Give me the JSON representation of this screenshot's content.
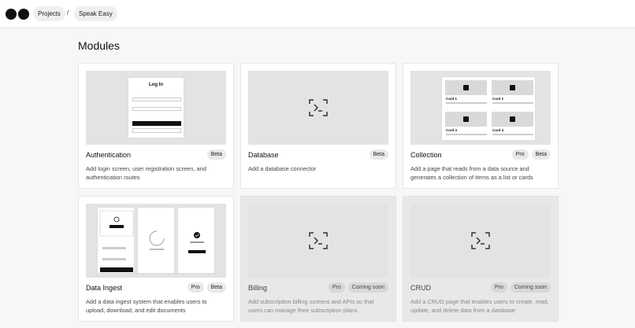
{
  "breadcrumb": {
    "projects": "Projects",
    "separator": "/",
    "current": "Speak Easy"
  },
  "page": {
    "title": "Modules"
  },
  "modules": [
    {
      "name": "Authentication",
      "badges": [
        "Beta"
      ],
      "description": "Add login screen, user registration screen, and authentication routes",
      "thumb": "login-mockup",
      "available": true
    },
    {
      "name": "Database",
      "badges": [
        "Beta"
      ],
      "description": "Add a database connector",
      "thumb": "terminal-icon",
      "available": true
    },
    {
      "name": "Collection",
      "badges": [
        "Pro",
        "Beta"
      ],
      "description": "Add a page that reads from a data source and generates a collection of items as a list or cards",
      "thumb": "cards-mockup",
      "available": true
    },
    {
      "name": "Data Ingest",
      "badges": [
        "Pro",
        "Beta"
      ],
      "description": "Add a data ingest system that enables users to upload, download, and edit documents",
      "thumb": "upload-mockup",
      "available": true
    },
    {
      "name": "Billing",
      "badges": [
        "Pro",
        "Coming soon"
      ],
      "description": "Add subscription billing screens and APIs so that users can manage their subscription plans",
      "thumb": "terminal-icon",
      "available": false
    },
    {
      "name": "CRUD",
      "badges": [
        "Pro",
        "Coming soon"
      ],
      "description": "Add a CRUD page that enables users to create, read, update, and delete data from a database",
      "thumb": "terminal-icon",
      "available": false
    }
  ],
  "mockups": {
    "login": {
      "title": "Log In"
    },
    "collection": {
      "cards": [
        "Card 1",
        "Card 2",
        "Card 3",
        "Card 4"
      ]
    }
  }
}
